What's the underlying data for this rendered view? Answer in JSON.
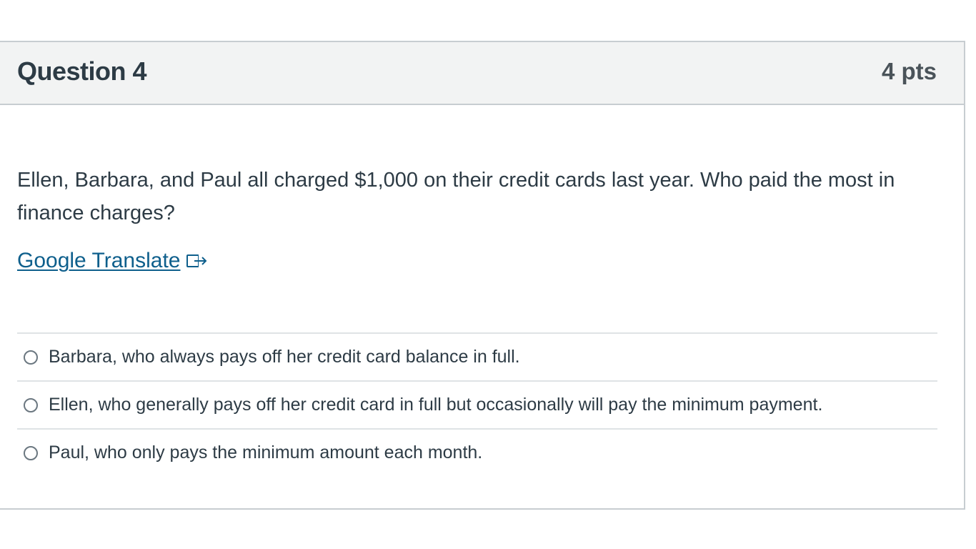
{
  "question": {
    "title": "Question 4",
    "points": "4 pts",
    "text": "Ellen, Barbara, and Paul all charged $1,000 on their credit cards last year.  Who paid the most in finance charges?",
    "translate_link": "Google Translate",
    "translate_icon": "external-link-icon"
  },
  "answers": [
    {
      "label": "Barbara, who always pays off her credit card balance in full.",
      "selected": false
    },
    {
      "label": "Ellen, who generally pays off her credit card in full but occasionally will pay the minimum payment.",
      "selected": false
    },
    {
      "label": "Paul, who only pays the minimum amount each month.",
      "selected": false
    }
  ],
  "colors": {
    "link": "#0e5f8c",
    "header_bg": "#f2f3f3",
    "border": "#c7cdd1",
    "text": "#2d3b45"
  }
}
